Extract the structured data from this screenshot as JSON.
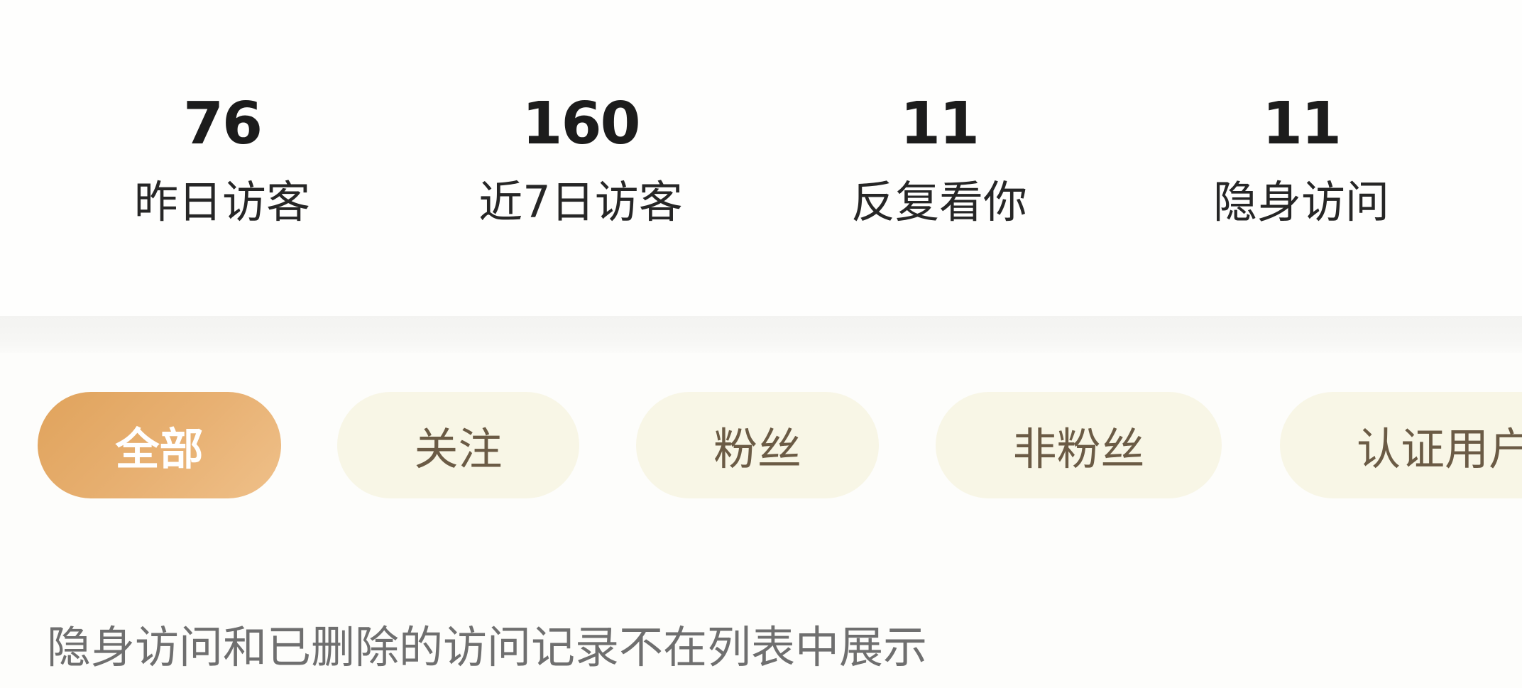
{
  "stats": [
    {
      "value": "76",
      "label": "昨日访客"
    },
    {
      "value": "160",
      "label": "近7日访客"
    },
    {
      "value": "11",
      "label": "反复看你"
    },
    {
      "value": "11",
      "label": "隐身访问"
    }
  ],
  "tabs": [
    {
      "label": "全部",
      "active": true
    },
    {
      "label": "关注",
      "active": false
    },
    {
      "label": "粉丝",
      "active": false
    },
    {
      "label": "非粉丝",
      "active": false
    },
    {
      "label": "认证用户",
      "active": false
    }
  ],
  "notice": "隐身访问和已删除的访问记录不在列表中展示",
  "colors": {
    "accent": "#e3a866",
    "tab_bg": "#f8f6e6",
    "tab_text": "#6b5b45"
  }
}
